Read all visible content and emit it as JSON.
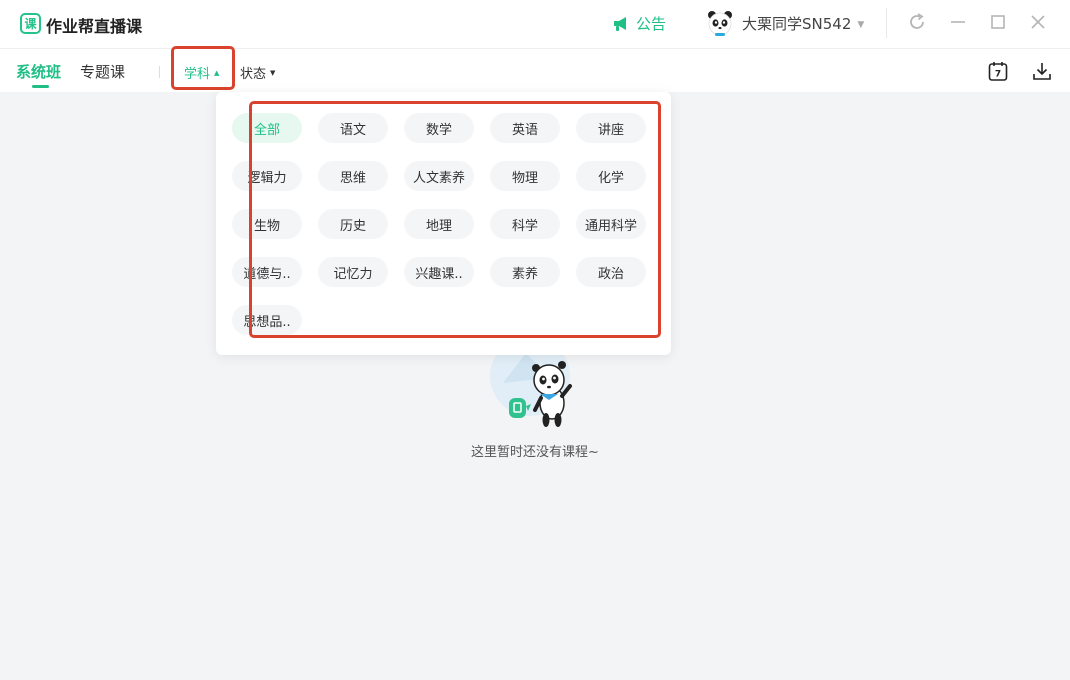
{
  "app": {
    "logo_char": "课",
    "title": "作业帮直播课"
  },
  "header": {
    "notice_label": "公告",
    "user_name": "大栗同学SN542"
  },
  "nav": {
    "tabs": [
      {
        "label": "系统班",
        "active": true
      },
      {
        "label": "专题课",
        "active": false
      }
    ],
    "filters": [
      {
        "label": "学科",
        "active": true
      },
      {
        "label": "状态",
        "active": false
      }
    ],
    "calendar_day": "7"
  },
  "subjects": {
    "selected": "全部",
    "items": [
      "全部",
      "语文",
      "数学",
      "英语",
      "讲座",
      "逻辑力",
      "思维",
      "人文素养",
      "物理",
      "化学",
      "生物",
      "历史",
      "地理",
      "科学",
      "通用科学",
      "道德与..",
      "记忆力",
      "兴趣课..",
      "素养",
      "政治",
      "思想品.."
    ]
  },
  "empty_state": {
    "message": "这里暂时还没有课程~"
  },
  "colors": {
    "brand": "#1fbf86",
    "highlight": "#d9432e",
    "background": "#f3f4f6"
  }
}
